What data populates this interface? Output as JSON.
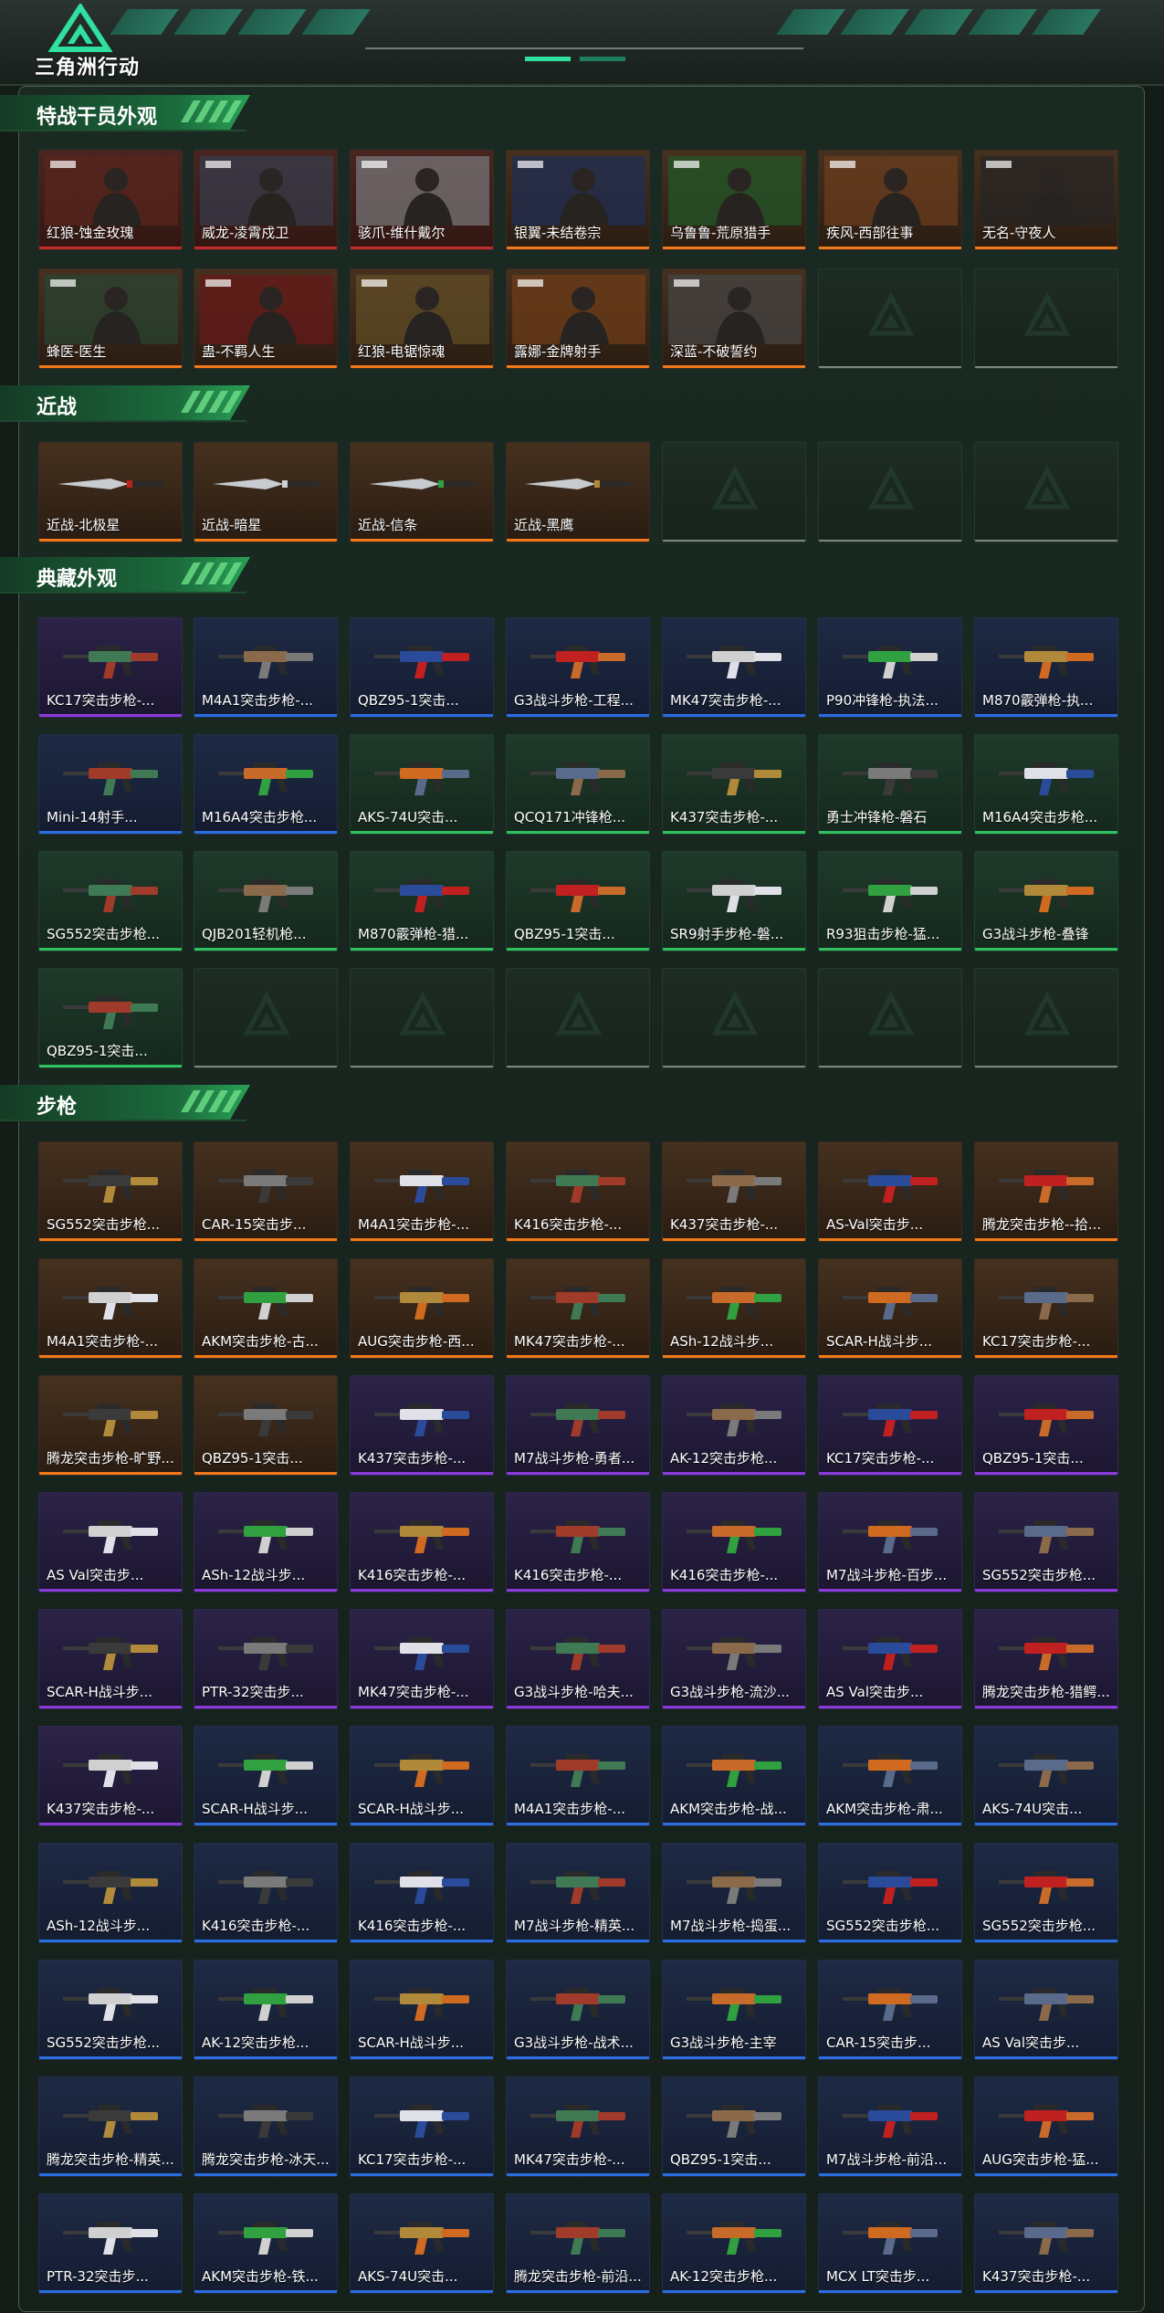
{
  "header": {
    "game_title": "三角洲行动"
  },
  "sections": [
    {
      "title": "特战干员外观",
      "items": [
        {
          "label": "红狼-蚀金玫瑰",
          "rarity": "red"
        },
        {
          "label": "威龙-凌霄戍卫",
          "rarity": "red"
        },
        {
          "label": "骇爪-维什戴尔",
          "rarity": "red"
        },
        {
          "label": "银翼-未结卷宗",
          "rarity": "orange"
        },
        {
          "label": "乌鲁鲁-荒原猎手",
          "rarity": "orange"
        },
        {
          "label": "疾风-西部往事",
          "rarity": "orange"
        },
        {
          "label": "无名-守夜人",
          "rarity": "orange"
        },
        {
          "label": "蜂医-医生",
          "rarity": "orange"
        },
        {
          "label": "蛊-不羁人生",
          "rarity": "orange"
        },
        {
          "label": "红狼-电锯惊魂",
          "rarity": "orange"
        },
        {
          "label": "露娜-金牌射手",
          "rarity": "orange"
        },
        {
          "label": "深蓝-不破誓约",
          "rarity": "orange"
        },
        {
          "label": "",
          "rarity": "empty"
        },
        {
          "label": "",
          "rarity": "empty"
        }
      ]
    },
    {
      "title": "近战",
      "items": [
        {
          "label": "近战-北极星",
          "rarity": "orange"
        },
        {
          "label": "近战-暗星",
          "rarity": "orange"
        },
        {
          "label": "近战-信条",
          "rarity": "orange"
        },
        {
          "label": "近战-黑鹰",
          "rarity": "orange"
        },
        {
          "label": "",
          "rarity": "empty"
        },
        {
          "label": "",
          "rarity": "empty"
        },
        {
          "label": "",
          "rarity": "empty"
        }
      ]
    },
    {
      "title": "典藏外观",
      "items": [
        {
          "label": "KC17突击步枪-...",
          "rarity": "purple"
        },
        {
          "label": "M4A1突击步枪-...",
          "rarity": "blue"
        },
        {
          "label": "QBZ95-1突击...",
          "rarity": "blue"
        },
        {
          "label": "G3战斗步枪-工程...",
          "rarity": "blue"
        },
        {
          "label": "MK47突击步枪-...",
          "rarity": "blue"
        },
        {
          "label": "P90冲锋枪-执法...",
          "rarity": "blue"
        },
        {
          "label": "M870霰弹枪-执...",
          "rarity": "blue"
        },
        {
          "label": "Mini-14射手...",
          "rarity": "blue"
        },
        {
          "label": "M16A4突击步枪...",
          "rarity": "blue"
        },
        {
          "label": "AKS-74U突击...",
          "rarity": "green"
        },
        {
          "label": "QCQ171冲锋枪...",
          "rarity": "green"
        },
        {
          "label": "K437突击步枪-...",
          "rarity": "green"
        },
        {
          "label": "勇士冲锋枪-磐石",
          "rarity": "green"
        },
        {
          "label": "M16A4突击步枪...",
          "rarity": "green"
        },
        {
          "label": "SG552突击步枪...",
          "rarity": "green"
        },
        {
          "label": "QJB201轻机枪...",
          "rarity": "green"
        },
        {
          "label": "M870霰弹枪-猎...",
          "rarity": "green"
        },
        {
          "label": "QBZ95-1突击...",
          "rarity": "green"
        },
        {
          "label": "SR9射手步枪-磐...",
          "rarity": "green"
        },
        {
          "label": "R93狙击步枪-猛...",
          "rarity": "green"
        },
        {
          "label": "G3战斗步枪-叠锋",
          "rarity": "green"
        },
        {
          "label": "QBZ95-1突击...",
          "rarity": "green"
        },
        {
          "label": "",
          "rarity": "empty"
        },
        {
          "label": "",
          "rarity": "empty"
        },
        {
          "label": "",
          "rarity": "empty"
        },
        {
          "label": "",
          "rarity": "empty"
        },
        {
          "label": "",
          "rarity": "empty"
        },
        {
          "label": "",
          "rarity": "empty"
        }
      ]
    },
    {
      "title": "步枪",
      "items": [
        {
          "label": "SG552突击步枪...",
          "rarity": "orange"
        },
        {
          "label": "CAR-15突击步...",
          "rarity": "orange"
        },
        {
          "label": "M4A1突击步枪-...",
          "rarity": "orange"
        },
        {
          "label": "K416突击步枪-...",
          "rarity": "orange"
        },
        {
          "label": "K437突击步枪-...",
          "rarity": "orange"
        },
        {
          "label": "AS-Val突击步...",
          "rarity": "orange"
        },
        {
          "label": "腾龙突击步枪--拾...",
          "rarity": "orange"
        },
        {
          "label": "M4A1突击步枪-...",
          "rarity": "orange"
        },
        {
          "label": "AKM突击步枪-古...",
          "rarity": "orange"
        },
        {
          "label": "AUG突击步枪-西...",
          "rarity": "orange"
        },
        {
          "label": "MK47突击步枪-...",
          "rarity": "orange"
        },
        {
          "label": "ASh-12战斗步...",
          "rarity": "orange"
        },
        {
          "label": "SCAR-H战斗步...",
          "rarity": "orange"
        },
        {
          "label": "KC17突击步枪-...",
          "rarity": "orange"
        },
        {
          "label": "腾龙突击步枪-旷野...",
          "rarity": "orange"
        },
        {
          "label": "QBZ95-1突击...",
          "rarity": "orange"
        },
        {
          "label": "K437突击步枪-...",
          "rarity": "purple"
        },
        {
          "label": "M7战斗步枪-勇者...",
          "rarity": "purple"
        },
        {
          "label": "AK-12突击步枪...",
          "rarity": "purple"
        },
        {
          "label": "KC17突击步枪-...",
          "rarity": "purple"
        },
        {
          "label": "QBZ95-1突击...",
          "rarity": "purple"
        },
        {
          "label": "AS Val突击步...",
          "rarity": "purple"
        },
        {
          "label": "ASh-12战斗步...",
          "rarity": "purple"
        },
        {
          "label": "K416突击步枪-...",
          "rarity": "purple"
        },
        {
          "label": "K416突击步枪-...",
          "rarity": "purple"
        },
        {
          "label": "K416突击步枪-...",
          "rarity": "purple"
        },
        {
          "label": "M7战斗步枪-百步...",
          "rarity": "purple"
        },
        {
          "label": "SG552突击步枪...",
          "rarity": "purple"
        },
        {
          "label": "SCAR-H战斗步...",
          "rarity": "purple"
        },
        {
          "label": "PTR-32突击步...",
          "rarity": "purple"
        },
        {
          "label": "MK47突击步枪-...",
          "rarity": "purple"
        },
        {
          "label": "G3战斗步枪-哈夫...",
          "rarity": "purple"
        },
        {
          "label": "G3战斗步枪-流沙...",
          "rarity": "purple"
        },
        {
          "label": "AS Val突击步...",
          "rarity": "purple"
        },
        {
          "label": "腾龙突击步枪-猎鳄...",
          "rarity": "purple"
        },
        {
          "label": "K437突击步枪-...",
          "rarity": "purple"
        },
        {
          "label": "SCAR-H战斗步...",
          "rarity": "blue"
        },
        {
          "label": "SCAR-H战斗步...",
          "rarity": "blue"
        },
        {
          "label": "M4A1突击步枪-...",
          "rarity": "blue"
        },
        {
          "label": "AKM突击步枪-战...",
          "rarity": "blue"
        },
        {
          "label": "AKM突击步枪-肃...",
          "rarity": "blue"
        },
        {
          "label": "AKS-74U突击...",
          "rarity": "blue"
        },
        {
          "label": "ASh-12战斗步...",
          "rarity": "blue"
        },
        {
          "label": "K416突击步枪-...",
          "rarity": "blue"
        },
        {
          "label": "K416突击步枪-...",
          "rarity": "blue"
        },
        {
          "label": "M7战斗步枪-精英...",
          "rarity": "blue"
        },
        {
          "label": "M7战斗步枪-捣蛋...",
          "rarity": "blue"
        },
        {
          "label": "SG552突击步枪...",
          "rarity": "blue"
        },
        {
          "label": "SG552突击步枪...",
          "rarity": "blue"
        },
        {
          "label": "SG552突击步枪...",
          "rarity": "blue"
        },
        {
          "label": "AK-12突击步枪...",
          "rarity": "blue"
        },
        {
          "label": "SCAR-H战斗步...",
          "rarity": "blue"
        },
        {
          "label": "G3战斗步枪-战术...",
          "rarity": "blue"
        },
        {
          "label": "G3战斗步枪-主宰",
          "rarity": "blue"
        },
        {
          "label": "CAR-15突击步...",
          "rarity": "blue"
        },
        {
          "label": "AS Val突击步...",
          "rarity": "blue"
        },
        {
          "label": "腾龙突击步枪-精英...",
          "rarity": "blue"
        },
        {
          "label": "腾龙突击步枪-冰天...",
          "rarity": "blue"
        },
        {
          "label": "KC17突击步枪-...",
          "rarity": "blue"
        },
        {
          "label": "MK47突击步枪-...",
          "rarity": "blue"
        },
        {
          "label": "QBZ95-1突击...",
          "rarity": "blue"
        },
        {
          "label": "M7战斗步枪-前沿...",
          "rarity": "blue"
        },
        {
          "label": "AUG突击步枪-猛...",
          "rarity": "blue"
        },
        {
          "label": "PTR-32突击步...",
          "rarity": "blue"
        },
        {
          "label": "AKM突击步枪-铁...",
          "rarity": "blue"
        },
        {
          "label": "AKS-74U突击...",
          "rarity": "blue"
        },
        {
          "label": "腾龙突击步枪-前沿...",
          "rarity": "blue"
        },
        {
          "label": "AK-12突击步枪...",
          "rarity": "blue"
        },
        {
          "label": "MCX LT突击步...",
          "rarity": "blue"
        },
        {
          "label": "K437突击步枪-...",
          "rarity": "blue"
        }
      ]
    }
  ],
  "gun_palettes": [
    "#b08a3a",
    "#a03a2a",
    "#c86a2a",
    "#d06a20",
    "#5a6a8a",
    "#3a3a3a",
    "#7a7a7a",
    "#e0e0e8",
    "#3f7a55",
    "#8a6a4a",
    "#2a4a9a",
    "#c02020",
    "#d0d0d0",
    "#30a040"
  ]
}
